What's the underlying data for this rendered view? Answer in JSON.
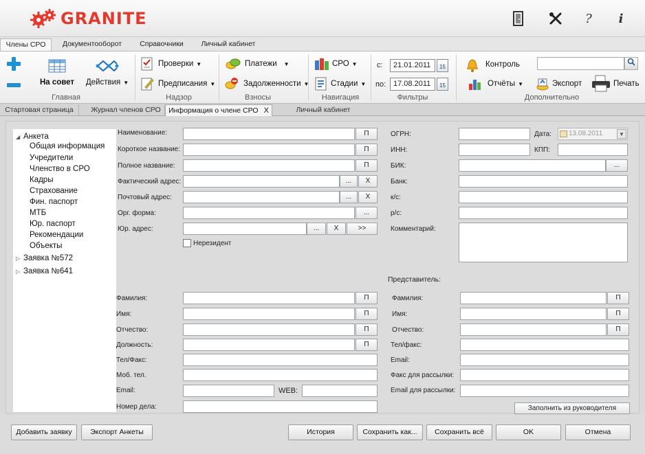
{
  "app": {
    "logo_text": "GRANITE"
  },
  "titlebar": {
    "icons": [
      "door-icon",
      "tools-icon",
      "help-icon",
      "info-icon"
    ],
    "help_glyph": "?",
    "info_glyph": "i"
  },
  "ribbon_tabs": [
    "Члены СРО",
    "Документооборот",
    "Справочники",
    "Личный кабинет"
  ],
  "ribbon": {
    "main": {
      "label": "Главная",
      "on_council": "На совет",
      "actions": "Действия"
    },
    "supervision": {
      "label": "Надзор",
      "checks": "Проверки",
      "orders": "Предписания"
    },
    "fees": {
      "label": "Взносы",
      "payments": "Платежи",
      "debts": "Задолженности"
    },
    "navigation": {
      "label": "Навигация",
      "sro": "СРО",
      "stages": "Стадии"
    },
    "filters": {
      "label": "Фильтры",
      "from_label": "с:",
      "from_value": "21.01.2011",
      "to_label": "по:",
      "to_value": "17.08.2011",
      "cal_day": "15"
    },
    "extra": {
      "label": "Дополнительно",
      "control": "Контроль",
      "reports": "Отчёты",
      "export": "Экспорт",
      "print": "Печать"
    }
  },
  "doc_tabs": [
    "Стартовая страница",
    "Журнал членов СРО",
    "Информация о члене СРО",
    "Личный кабинет"
  ],
  "doc_tab_close": "X",
  "tree": {
    "root": "Анкета",
    "children": [
      "Общая информация",
      "Учредители",
      "Членство в СРО",
      "Кадры",
      "Страхование",
      "Фин. паспорт",
      "МТБ",
      "Юр. паспорт",
      "Рекомендации",
      "Объекты"
    ],
    "requests": [
      "Заявка №572",
      "Заявка №641"
    ]
  },
  "form": {
    "name": "Наименование:",
    "short_name": "Короткое название:",
    "full_name": "Полное название:",
    "actual_address": "Фактический адрес:",
    "postal_address": "Почтовый адрес:",
    "org_form": "Орг. форма:",
    "legal_address": "Юр. адрес:",
    "nonresident": "Нерезидент",
    "ogrn": "ОГРН:",
    "date": "Дата:",
    "date_value": "13.08.2011",
    "inn": "ИНН:",
    "kpp": "КПП:",
    "bik": "БИК:",
    "bank": "Банк:",
    "ks": "к/с:",
    "rs": "р/с:",
    "comment": "Комментарий:",
    "btn_p": "П",
    "btn_dots": "...",
    "btn_x": "X",
    "btn_next": ">>"
  },
  "person": {
    "surname": "Фамилия:",
    "first_name": "Имя:",
    "patronymic": "Отчество:",
    "position": "Должность:",
    "phone_fax": "Тел/Факс:",
    "mobile": "Моб. тел.",
    "email": "Email:",
    "web": "WEB:",
    "case_number": "Номер дела:"
  },
  "representative": {
    "title": "Представитель:",
    "surname": "Фамилия:",
    "first_name": "Имя:",
    "patronymic": "Отчество:",
    "phone_fax": "Тел/факс:",
    "email": "Email:",
    "mail_fax": "Факс для рассылки:",
    "mail_email": "Email для рассылки:",
    "fill_from_head": "Заполнить из руководителя"
  },
  "footer": {
    "add_request": "Добавить заявку",
    "export_form": "Экспорт Анкеты",
    "history": "История",
    "save_as": "Сохранить как...",
    "save_all": "Сохранить всё",
    "ok": "OK",
    "cancel": "Отмена"
  },
  "colors": {
    "brand": "#e23b2e",
    "accent": "#1f8fd6"
  }
}
